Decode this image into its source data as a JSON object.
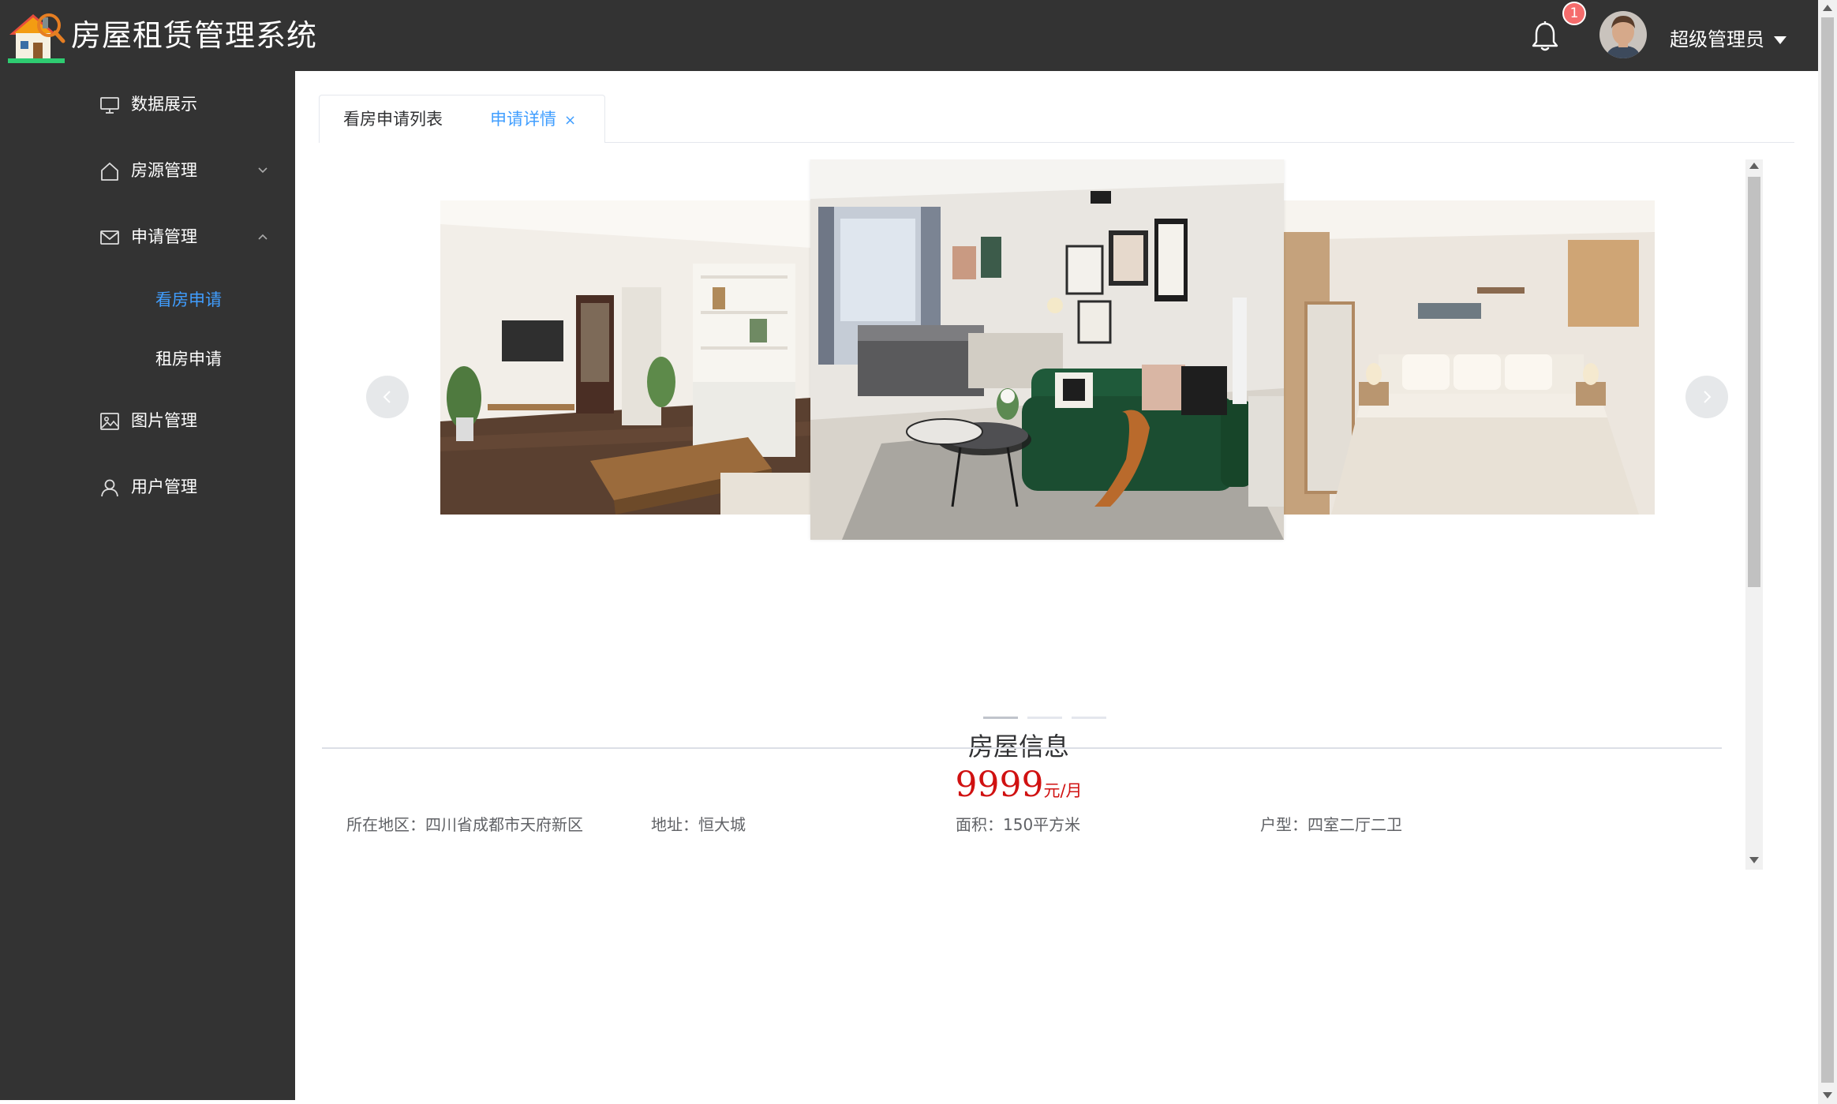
{
  "app": {
    "title": "房屋租赁管理系统"
  },
  "header": {
    "notification_count": "1",
    "user_name": "超级管理员"
  },
  "sidebar": {
    "items": [
      {
        "label": "数据展示",
        "icon": "monitor-icon"
      },
      {
        "label": "房源管理",
        "icon": "home-icon",
        "expanded": false
      },
      {
        "label": "申请管理",
        "icon": "mail-icon",
        "expanded": true,
        "children": [
          {
            "label": "看房申请",
            "active": true
          },
          {
            "label": "租房申请",
            "active": false
          }
        ]
      },
      {
        "label": "图片管理",
        "icon": "image-icon"
      },
      {
        "label": "用户管理",
        "icon": "user-icon"
      }
    ]
  },
  "tabs": [
    {
      "label": "看房申请列表",
      "active": false
    },
    {
      "label": "申请详情",
      "active": true,
      "closable": true,
      "close_glyph": "×"
    }
  ],
  "carousel": {
    "slides": [
      "living-room-photo",
      "sofa-living-room-photo",
      "bedroom-photo"
    ],
    "active_index": 0,
    "indicator_count": 3
  },
  "house": {
    "title": "房屋信息",
    "price": "9999",
    "price_unit": "元/月",
    "region": "所在地区：四川省成都市天府新区",
    "address": "地址：恒大城",
    "area": "面积：150平方米",
    "layout": "户型：四室二厅二卫"
  },
  "colors": {
    "header_bg": "#333333",
    "sidebar_bg": "#333333",
    "accent": "#409eff",
    "price": "#d01111",
    "badge": "#f56c6c"
  }
}
